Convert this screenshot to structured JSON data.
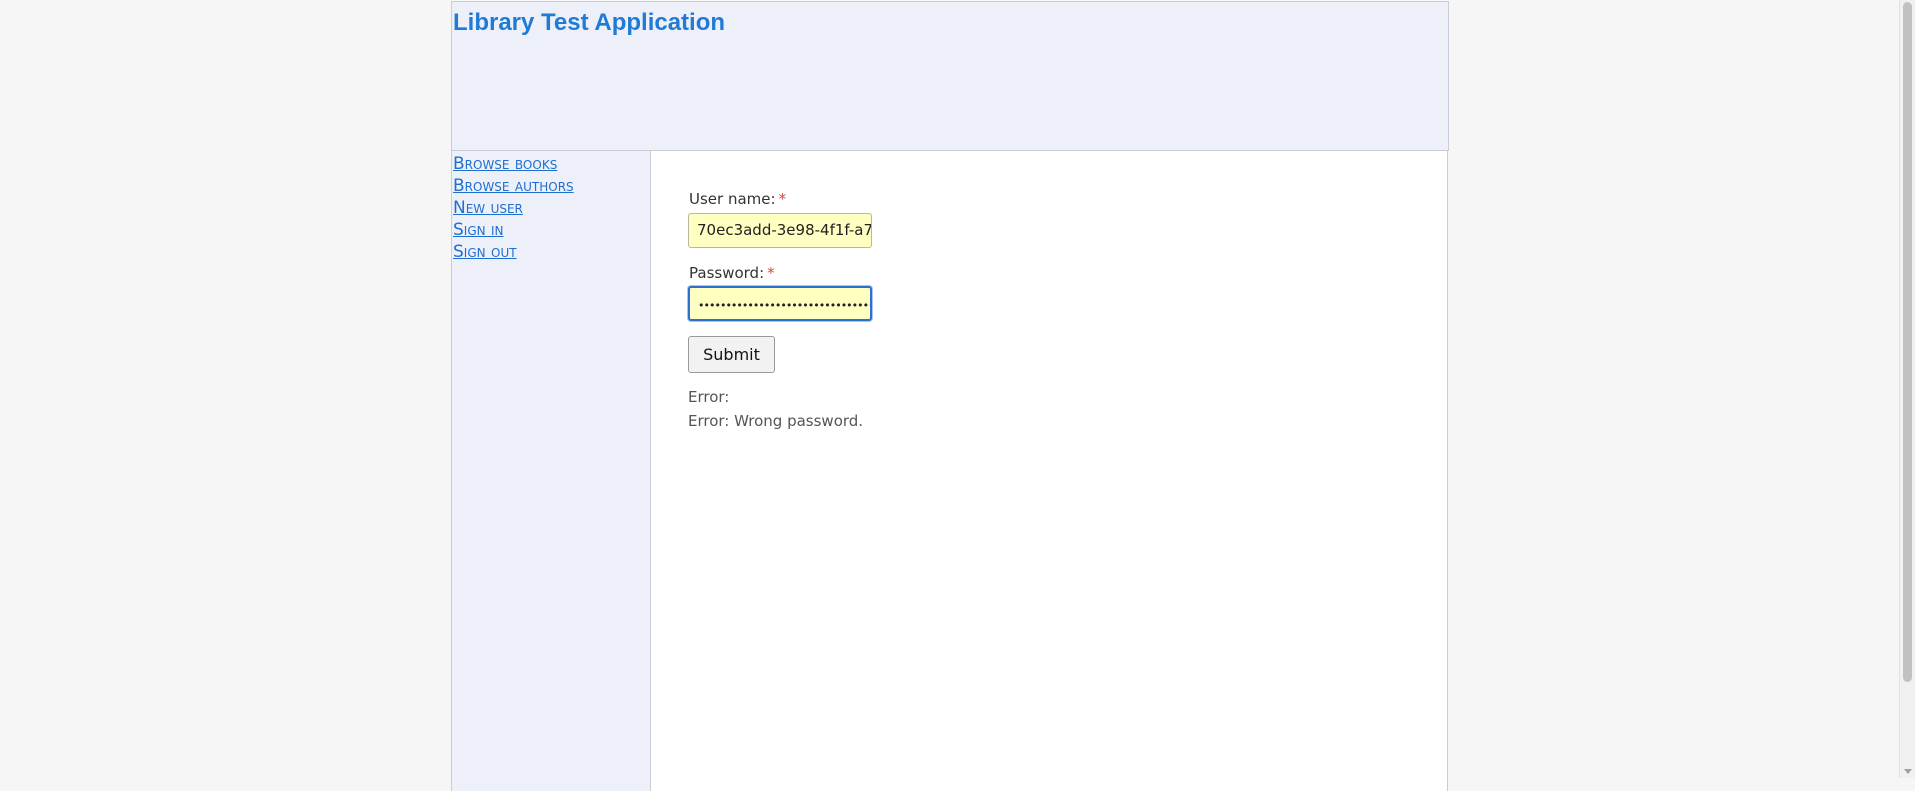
{
  "header": {
    "title": "Library Test Application"
  },
  "sidebar": {
    "items": [
      {
        "label": "Browse books"
      },
      {
        "label": "Browse authors"
      },
      {
        "label": "New user"
      },
      {
        "label": "Sign in"
      },
      {
        "label": "Sign out"
      }
    ]
  },
  "form": {
    "username": {
      "label": "User name:",
      "required_marker": "*",
      "value": "70ec3add-3e98-4f1f-a7"
    },
    "password": {
      "label": "Password:",
      "required_marker": "*",
      "masked_value": "••••••••••••••••••••••••••••••••••••"
    },
    "submit_label": "Submit"
  },
  "errors": [
    "Error:",
    "Error: Wrong password."
  ],
  "colors": {
    "accent": "#1f7bd6",
    "panel_background": "#edf0f9",
    "input_background": "#ffffc2",
    "required": "#e0443a"
  }
}
